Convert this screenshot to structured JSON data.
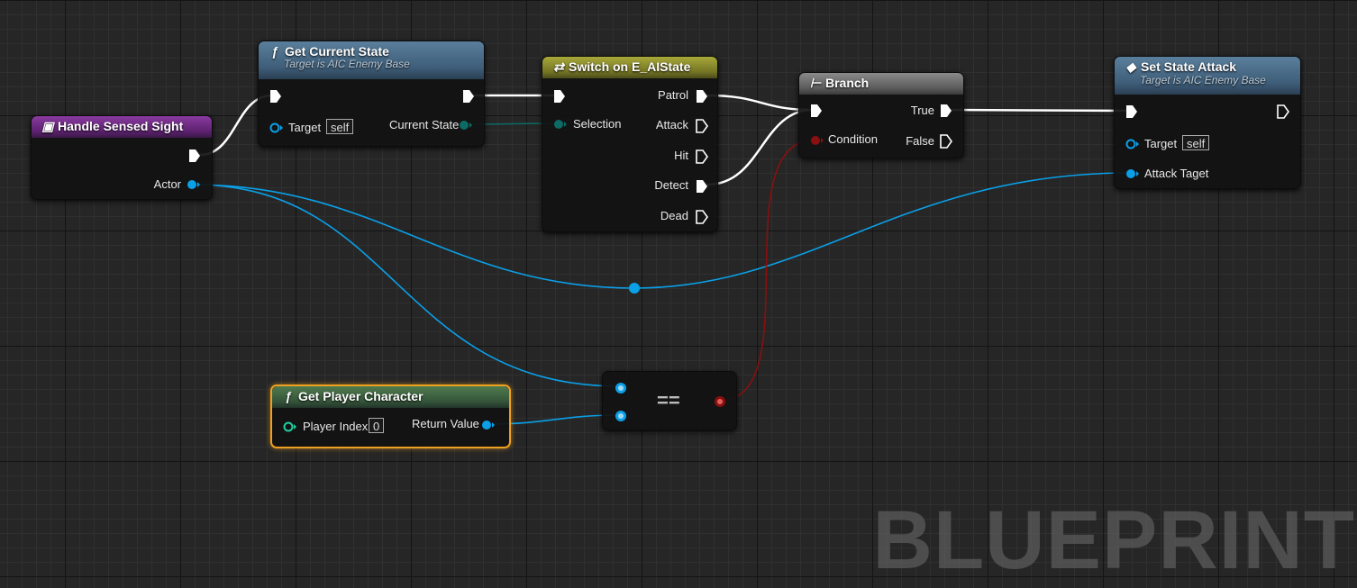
{
  "nodes": {
    "handle_sensed_sight": {
      "title": "Handle Sensed Sight",
      "actor_label": "Actor"
    },
    "get_current_state": {
      "title": "Get Current State",
      "subtitle": "Target is AIC Enemy Base",
      "target_label": "Target",
      "target_value": "self",
      "output_label": "Current State"
    },
    "switch": {
      "title": "Switch on E_AIState",
      "selection_label": "Selection",
      "outputs": [
        "Patrol",
        "Attack",
        "Hit",
        "Detect",
        "Dead"
      ]
    },
    "branch": {
      "title": "Branch",
      "condition_label": "Condition",
      "true_label": "True",
      "false_label": "False"
    },
    "set_state_attack": {
      "title": "Set State Attack",
      "subtitle": "Target is AIC Enemy Base",
      "target_label": "Target",
      "target_value": "self",
      "attack_target_label": "Attack Taget"
    },
    "get_player_character": {
      "title": "Get Player Character",
      "player_index_label": "Player Index",
      "player_index_value": "0",
      "return_label": "Return Value"
    },
    "equal": {
      "operator": "=="
    }
  },
  "watermark": "BLUEPRINT",
  "colors": {
    "exec": "#ffffff",
    "object": "#0aa0e8",
    "enum": "#0c6b64",
    "bool": "#8a0f0f",
    "selected_outline": "#f0a020"
  }
}
